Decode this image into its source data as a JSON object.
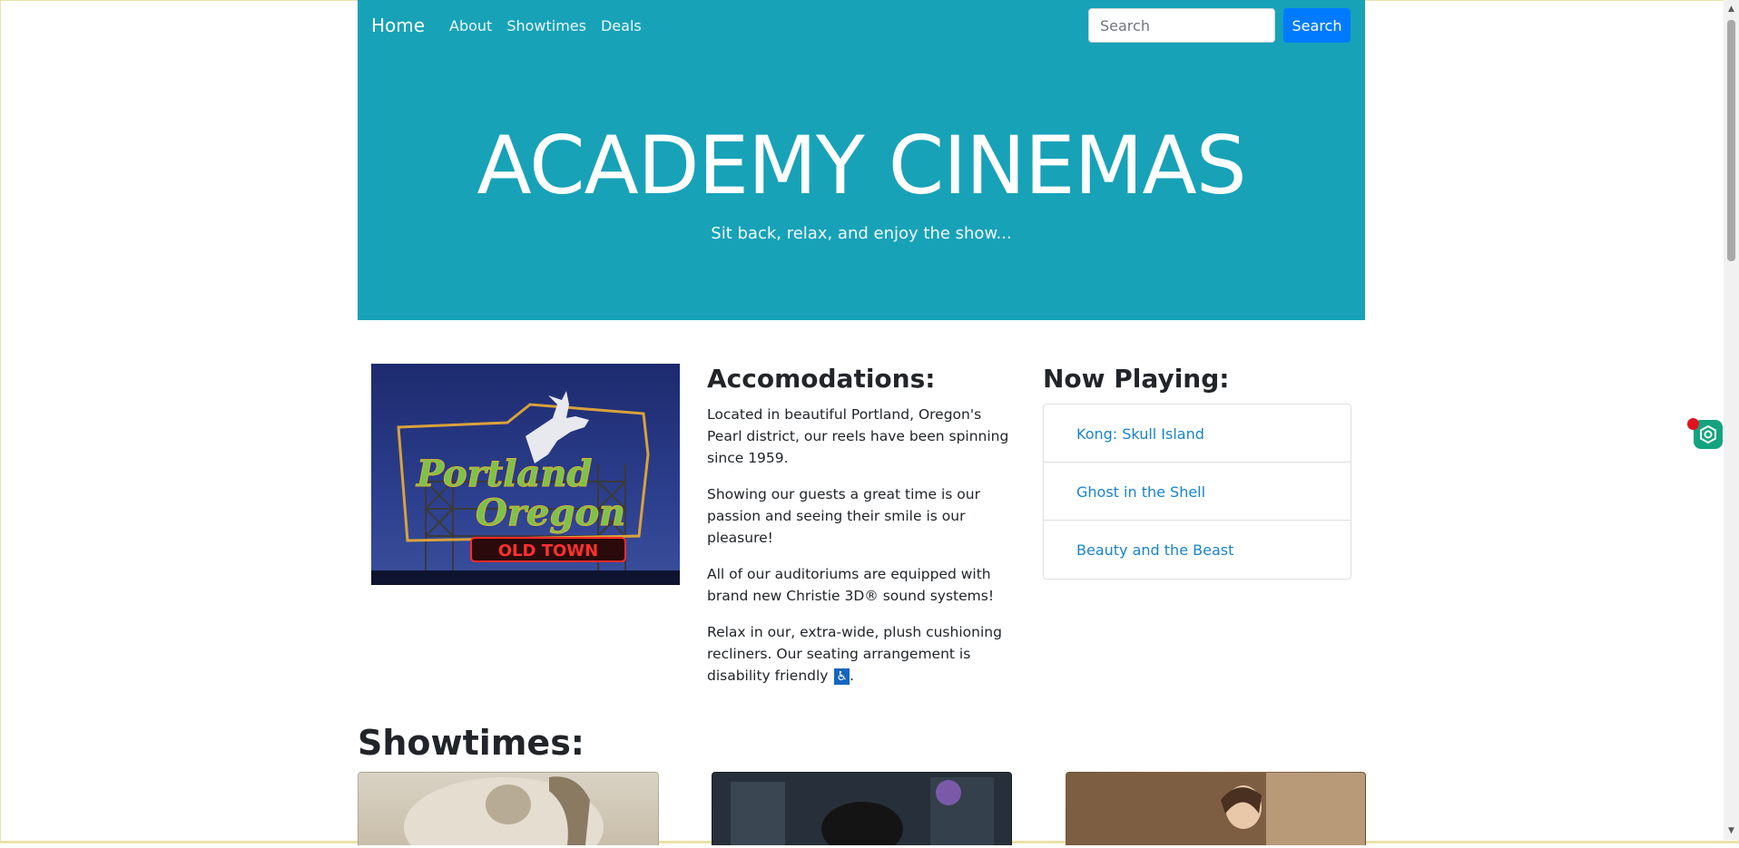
{
  "navbar": {
    "brand": "Home",
    "links": [
      "About",
      "Showtimes",
      "Deals"
    ],
    "search_placeholder": "Search",
    "search_button": "Search"
  },
  "hero": {
    "title": "ACADEMY CINEMAS",
    "subtitle": "Sit back, relax, and enjoy the show..."
  },
  "accommodations": {
    "heading": "Accomodations:",
    "paragraphs": [
      "Located in beautiful Portland, Oregon's Pearl district, our reels have been spinning since 1959.",
      "Showing our guests a great time is our passion and seeing their smile is our pleasure!",
      "All of our auditoriums are equipped with brand new Christie 3D® sound systems!",
      "Relax in our, extra-wide, plush cushioning recliners. Our seating arrangement is disability friendly"
    ],
    "accessibility_icon": "♿",
    "trailing": "."
  },
  "now_playing": {
    "heading": "Now Playing:",
    "movies": [
      "Kong: Skull Island",
      "Ghost in the Shell",
      "Beauty and the Beast"
    ]
  },
  "showtimes": {
    "heading": "Showtimes:"
  },
  "image_sign": {
    "line1": "Portland",
    "line2": "Oregon",
    "line3": "OLD TOWN"
  },
  "colors": {
    "hero_bg": "#17a2b8",
    "search_button": "#007bff",
    "link": "#1a83c8",
    "widget": "#14a37f",
    "widget_badge": "#e0141e"
  },
  "icons": {
    "widget": "hexagon-gear-icon",
    "scroll_up": "triangle-up-icon",
    "scroll_down": "triangle-down-icon"
  }
}
